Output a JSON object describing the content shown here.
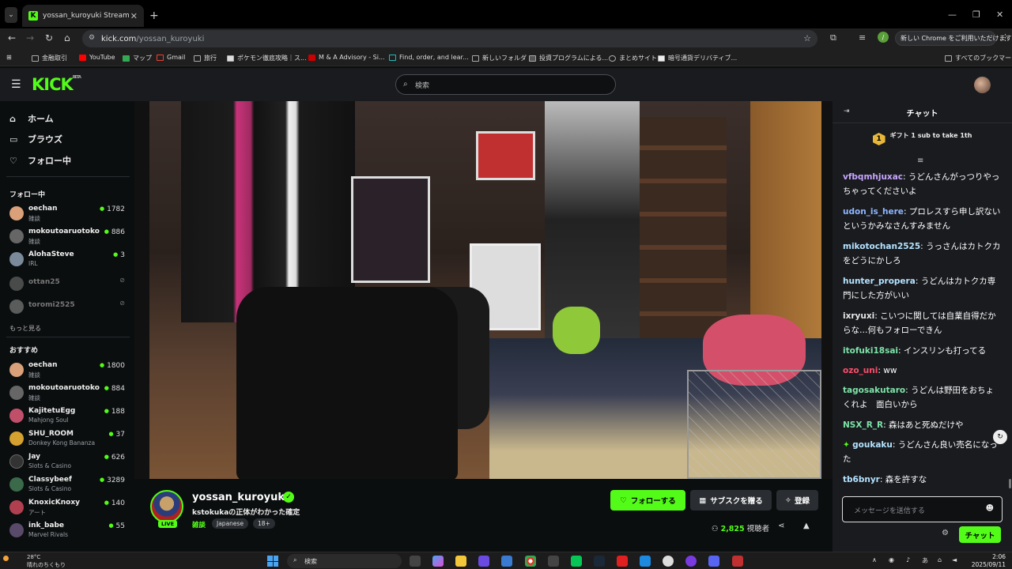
{
  "browser": {
    "tab_title": "yossan_kuroyuki Stream - Watc",
    "tab_favicon": "K",
    "url_host": "kick.com",
    "url_path": "/yossan_kuroyuki",
    "chrome_pill": "新しい Chrome をご利用いただけます",
    "profile_initial": "/",
    "bookmarks": [
      "金融取引",
      "YouTube",
      "マップ",
      "Gmail",
      "旅行",
      "ポケモン徹底攻略｜ス...",
      "M & A Advisory - Si...",
      "Find, order, and lear...",
      "新しいフォルダ",
      "投資プログラムによる...",
      "まとめサイト",
      "暗号通貨デリバティブ..."
    ],
    "all_bookmarks": "すべてのブックマーク"
  },
  "kick": {
    "logo": "KICK",
    "logo_beta": "BETA",
    "search_placeholder": "検索",
    "nav": {
      "home": "ホーム",
      "browse": "ブラウズ",
      "following": "フォロー中"
    },
    "following_header": "フォロー中",
    "following": [
      {
        "name": "oechan",
        "category": "雑談",
        "viewers": "1782",
        "color": "#d9a07a"
      },
      {
        "name": "mokoutoaruotoko",
        "category": "雑談",
        "viewers": "886",
        "color": "#666"
      },
      {
        "name": "AlohaSteve",
        "category": "IRL",
        "viewers": "3",
        "color": "#7a8a9a"
      },
      {
        "name": "ottan25",
        "color": "#888"
      },
      {
        "name": "toromi2525",
        "color": "#aaa"
      }
    ],
    "see_more": "もっと見る",
    "recommended_header": "おすすめ",
    "recommended": [
      {
        "name": "oechan",
        "category": "雑談",
        "viewers": "1800",
        "color": "#d9a07a"
      },
      {
        "name": "mokoutoaruotoko",
        "category": "雑談",
        "viewers": "884",
        "color": "#666"
      },
      {
        "name": "KajitetuEgg",
        "category": "Mahjong Soul",
        "viewers": "188",
        "color": "#c0506a"
      },
      {
        "name": "SHU_ROOM",
        "category": "Donkey Kong Bananza",
        "viewers": "37",
        "color": "#d4a030"
      },
      {
        "name": "Jay",
        "category": "Slots & Casino",
        "viewers": "626",
        "color": "#333"
      },
      {
        "name": "Classybeef",
        "category": "Slots & Casino",
        "viewers": "3289",
        "color": "#3a6a4a"
      },
      {
        "name": "KnoxicKnoxy",
        "category": "アート",
        "viewers": "140",
        "color": "#b04050"
      },
      {
        "name": "ink_babe",
        "category": "Marvel Rivals",
        "viewers": "55",
        "color": "#5a4a6a"
      }
    ],
    "stream": {
      "streamer": "yossan_kuroyuki",
      "title": "kstokukaの正体がわかった確定",
      "category": "雑談",
      "tags": [
        "Japanese",
        "18+"
      ],
      "live_label": "LIVE",
      "follow_label": "フォローする",
      "sub_label": "サブスクを贈る",
      "register_label": "登録",
      "viewer_count": "2,825",
      "viewer_suffix": "視聴者"
    },
    "chat": {
      "title": "チャット",
      "gift_rank": "1",
      "gift_text": "ギフト 1 sub to take 1th",
      "messages": [
        {
          "user": "vfbqmhjuxac",
          "color": "#c7a6ff",
          "text": "うどんさんがっつりやっちゃってくださいよ"
        },
        {
          "user": "udon_is_here",
          "color": "#8fb6ff",
          "text": "プロレスすら申し訳ないというかみなさんすみません"
        },
        {
          "user": "mikotochan2525",
          "color": "#b4e3ff",
          "text": "うっさんはカトクカをどうにかしろ"
        },
        {
          "user": "hunter_propera",
          "color": "#b4e3ff",
          "text": "うどんはカトクカ専門にした方がいい"
        },
        {
          "user": "ixryuxi",
          "color": "#e6e6e6",
          "text": "こいつに関しては自業自得だからな…何もフォローできん"
        },
        {
          "user": "itofuki18sai",
          "color": "#7ee3a8",
          "text": "インスリンも打ってる"
        },
        {
          "user": "ozo_uni",
          "color": "#ff4d6a",
          "text": "ww"
        },
        {
          "user": "tagosakutaro",
          "color": "#7ee3a8",
          "text": "うどんは野田をおちょくれよ　面白いから"
        },
        {
          "user": "NSX_R_R",
          "color": "#7ee3a8",
          "text": "森はあと死ぬだけや"
        },
        {
          "user": "goukaku",
          "color": "#b4e3ff",
          "text": "うどんさん良い売名になった"
        },
        {
          "user": "tb6bnyr",
          "color": "#b4e3ff",
          "text": "森を許すな"
        }
      ],
      "input_placeholder": "メッセージを送信する",
      "send_label": "チャット"
    }
  },
  "taskbar": {
    "weather_temp": "28°C",
    "weather_text": "晴れのちくもり",
    "search_label": "検索",
    "ime": "あ",
    "time": "2:06",
    "date": "2025/09/11"
  }
}
